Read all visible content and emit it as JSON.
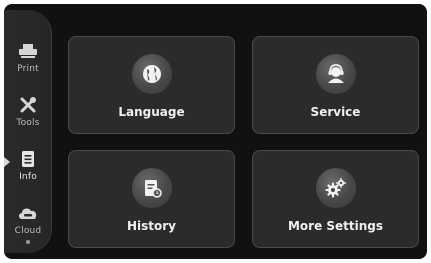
{
  "sidebar": {
    "items": [
      {
        "label": "Print",
        "icon": "printer-icon"
      },
      {
        "label": "Tools",
        "icon": "tools-icon"
      },
      {
        "label": "Info",
        "icon": "info-document-icon"
      },
      {
        "label": "Cloud",
        "icon": "cloud-icon"
      }
    ],
    "active": "Info"
  },
  "tiles": {
    "language": {
      "label": "Language",
      "icon": "globe-icon"
    },
    "service": {
      "label": "Service",
      "icon": "headset-icon"
    },
    "history": {
      "label": "History",
      "icon": "history-document-icon"
    },
    "more_settings": {
      "label": "More Settings",
      "icon": "gears-icon"
    }
  },
  "colors": {
    "background": "#111111",
    "tile": "#2b2b2b",
    "tile_border": "#4a4a4a",
    "text": "#f0f0f0"
  }
}
